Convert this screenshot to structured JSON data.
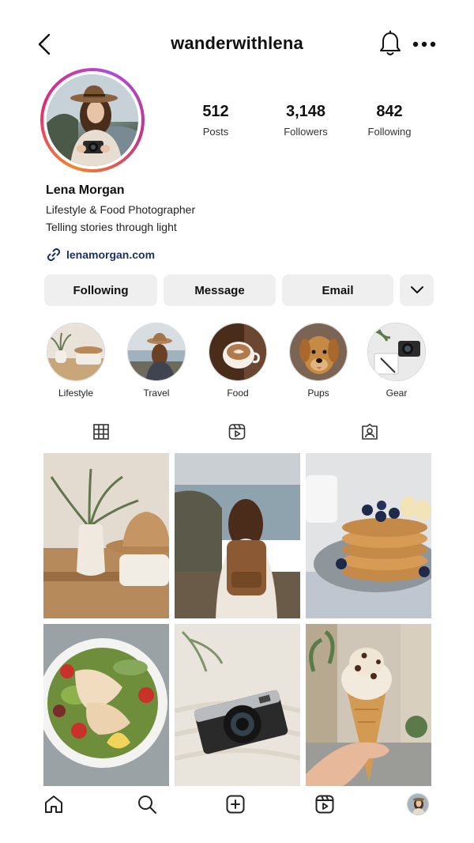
{
  "header": {
    "username": "wanderwithlena",
    "back_icon": "chevron-left-icon",
    "notification_icon": "bell-icon",
    "more_icon": "more-dots-icon"
  },
  "profile": {
    "name": "Lena Morgan",
    "bio_line_1": "Lifestyle & Food Photographer",
    "bio_line_2": "Telling stories through light",
    "link": "lenamorgan.com",
    "stats": [
      {
        "value": "512",
        "label": "Posts"
      },
      {
        "value": "3,148",
        "label": "Followers"
      },
      {
        "value": "842",
        "label": "Following"
      }
    ]
  },
  "actions": {
    "following": "Following",
    "message": "Message",
    "email": "Email",
    "expand_icon": "chevron-down-icon"
  },
  "highlights": [
    {
      "label": "Lifestyle"
    },
    {
      "label": "Travel"
    },
    {
      "label": "Food"
    },
    {
      "label": "Pups"
    },
    {
      "label": "Gear"
    }
  ],
  "tabs": [
    {
      "icon": "grid-icon"
    },
    {
      "icon": "reels-icon"
    },
    {
      "icon": "tagged-icon"
    }
  ],
  "posts": [
    {
      "subject": "plant-vase-and-hat"
    },
    {
      "subject": "woman-with-backpack-at-coast"
    },
    {
      "subject": "pancakes-with-blueberries"
    },
    {
      "subject": "chicken-salad-bowl"
    },
    {
      "subject": "vintage-camera-on-knit"
    },
    {
      "subject": "ice-cream-cone-street"
    }
  ],
  "bottom_nav": [
    {
      "icon": "home-icon"
    },
    {
      "icon": "search-icon"
    },
    {
      "icon": "create-icon"
    },
    {
      "icon": "reels-icon"
    },
    {
      "icon": "profile-avatar"
    }
  ],
  "colors": {
    "ring_start": "#f58529",
    "ring_mid": "#dd2a7b",
    "ring_end": "#b04bd6",
    "button_bg": "#efefef",
    "link_color": "#1d3160"
  }
}
